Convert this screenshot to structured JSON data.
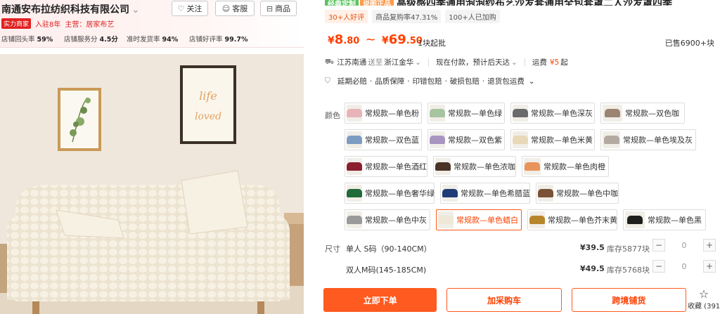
{
  "shop": {
    "name": "南通安布拉纺织科技有限公司",
    "follow_label": "关注",
    "service_label": "客服",
    "products_label": "商品",
    "badge": "实力商家",
    "years": "入驻8年",
    "main_category": "主营：居家布艺",
    "stats": [
      {
        "label": "店铺回头率",
        "value": "59%"
      },
      {
        "label": "店铺服务分",
        "value": "4.5分"
      },
      {
        "label": "准时发货率",
        "value": "94%"
      },
      {
        "label": "店铺好评率",
        "value": "99.7%"
      }
    ]
  },
  "photo": {
    "frame_lines": [
      "life",
      "loved"
    ]
  },
  "product": {
    "title_tag1": "经典定制",
    "title_tag2": "说图正品",
    "title": "高级感四季通用泡泡纱布艺沙发套通用全包套罩二人沙发罩四季",
    "tags": [
      "30+人好评",
      "商品复购率47.31%",
      "100+人已加购"
    ],
    "price_low_int": "8",
    "price_low_dec": ".80",
    "price_sep": "~",
    "price_high_int": "69",
    "price_high_dec": ".50",
    "currency": "¥",
    "min_order": "1块起批",
    "sold": "已售6900+块",
    "shipping": {
      "from": "江苏南通",
      "to_word": "送至",
      "to": "浙江金华",
      "stock": "现在付款，预计后天达",
      "freight_label": "运费",
      "freight": "¥5",
      "freight_suffix": "起"
    },
    "services": [
      "延期必赔",
      "品质保障",
      "印错包赔",
      "破损包赔",
      "退货包运费"
    ]
  },
  "sku": {
    "color_label": "颜色",
    "size_label": "尺寸",
    "colors": [
      {
        "label": "常规款—单色粉",
        "color": "#e8b4b8",
        "selected": false
      },
      {
        "label": "常规款—单色绿",
        "color": "#a7c4a0",
        "selected": false
      },
      {
        "label": "常规款—单色深灰",
        "color": "#6b6b6e",
        "selected": false
      },
      {
        "label": "常规款—双色咖",
        "color": "#9b8472",
        "selected": false
      },
      {
        "label": "常规款—双色蓝",
        "color": "#7c9cc2",
        "selected": false
      },
      {
        "label": "常规款—双色紫",
        "color": "#a895c0",
        "selected": false
      },
      {
        "label": "常规款—单色米黄",
        "color": "#e8d8b8",
        "selected": false
      },
      {
        "label": "常规款—单色埃及灰",
        "color": "#b3aaa2",
        "selected": false
      },
      {
        "label": "常规款—单色酒红",
        "color": "#8a1f2e",
        "selected": false
      },
      {
        "label": "常规款—单色浓咖",
        "color": "#4a3226",
        "selected": false
      },
      {
        "label": "常规款—单色肉橙",
        "color": "#e8945a",
        "selected": false
      },
      {
        "label": "常规款—单色奢华绿",
        "color": "#1f6b3a",
        "selected": false
      },
      {
        "label": "常规款—单色希腊蓝",
        "color": "#1f3c78",
        "selected": false
      },
      {
        "label": "常规款—单色中咖",
        "color": "#7a5236",
        "selected": false
      },
      {
        "label": "常规款—单色中灰",
        "color": "#9a9a9a",
        "selected": false
      },
      {
        "label": "常规款—单色蜡白",
        "color": "#efe8d8",
        "selected": true
      },
      {
        "label": "常规款—单色芥末黄",
        "color": "#b8862a",
        "selected": false
      },
      {
        "label": "常规款—单色黑",
        "color": "#1e1e1e",
        "selected": false
      }
    ],
    "sizes": [
      {
        "name": "单人 S码（90-140CM）",
        "price": "¥39.5",
        "stock": "库存5877块",
        "qty": "0"
      },
      {
        "name": "双人M码(145-185CM)",
        "price": "¥49.5",
        "stock": "库存5768块",
        "qty": "0"
      }
    ]
  },
  "actions": {
    "buy": "立即下单",
    "cart": "加采购车",
    "cross": "跨境铺货",
    "fav": "收藏 (391"
  },
  "colors": {
    "accent": "#ff4000",
    "button": "#ff5a1f"
  }
}
